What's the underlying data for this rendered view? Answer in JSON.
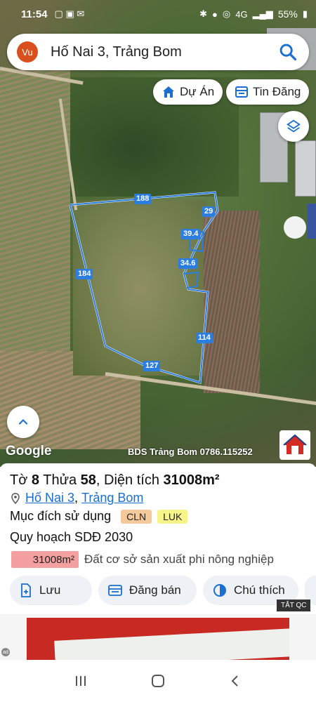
{
  "status_bar": {
    "time": "11:54",
    "battery": "55%",
    "network": "4G"
  },
  "search": {
    "avatar_initials": "Vu",
    "query": "Hố Nai 3, Trảng Bom"
  },
  "chips": {
    "du_an": "Dự Án",
    "tin_dang": "Tin Đăng"
  },
  "map": {
    "edge_labels": [
      "188",
      "29",
      "39.4",
      "34.6",
      "184",
      "114",
      "127"
    ],
    "google_logo": "Google",
    "watermark": "BDS Trảng Bom 0786.115252",
    "ad_label": "TẮT QC"
  },
  "parcel": {
    "to_label": "Tờ",
    "to_value": "8",
    "thua_label": "Thửa",
    "thua_value": "58",
    "area_label": ", Diện tích",
    "area_value": "31008m²",
    "ward": "Hố Nai 3",
    "district": "Trảng Bom",
    "purpose_label": "Mục đích sử dụng",
    "tags": [
      "CLN",
      "LUK"
    ],
    "plan_label": "Quy hoạch SDĐ 2030",
    "plan_area": "31008m²",
    "plan_desc": "Đất cơ sở sản xuất phi nông nghiệp"
  },
  "actions": {
    "save": "Lưu",
    "post_sale": "Đăng bán",
    "legend": "Chú thích"
  },
  "colors": {
    "accent": "#1a6fd1",
    "parcel_outline": "#2b7de0",
    "avatar_bg": "#d94f1e"
  }
}
